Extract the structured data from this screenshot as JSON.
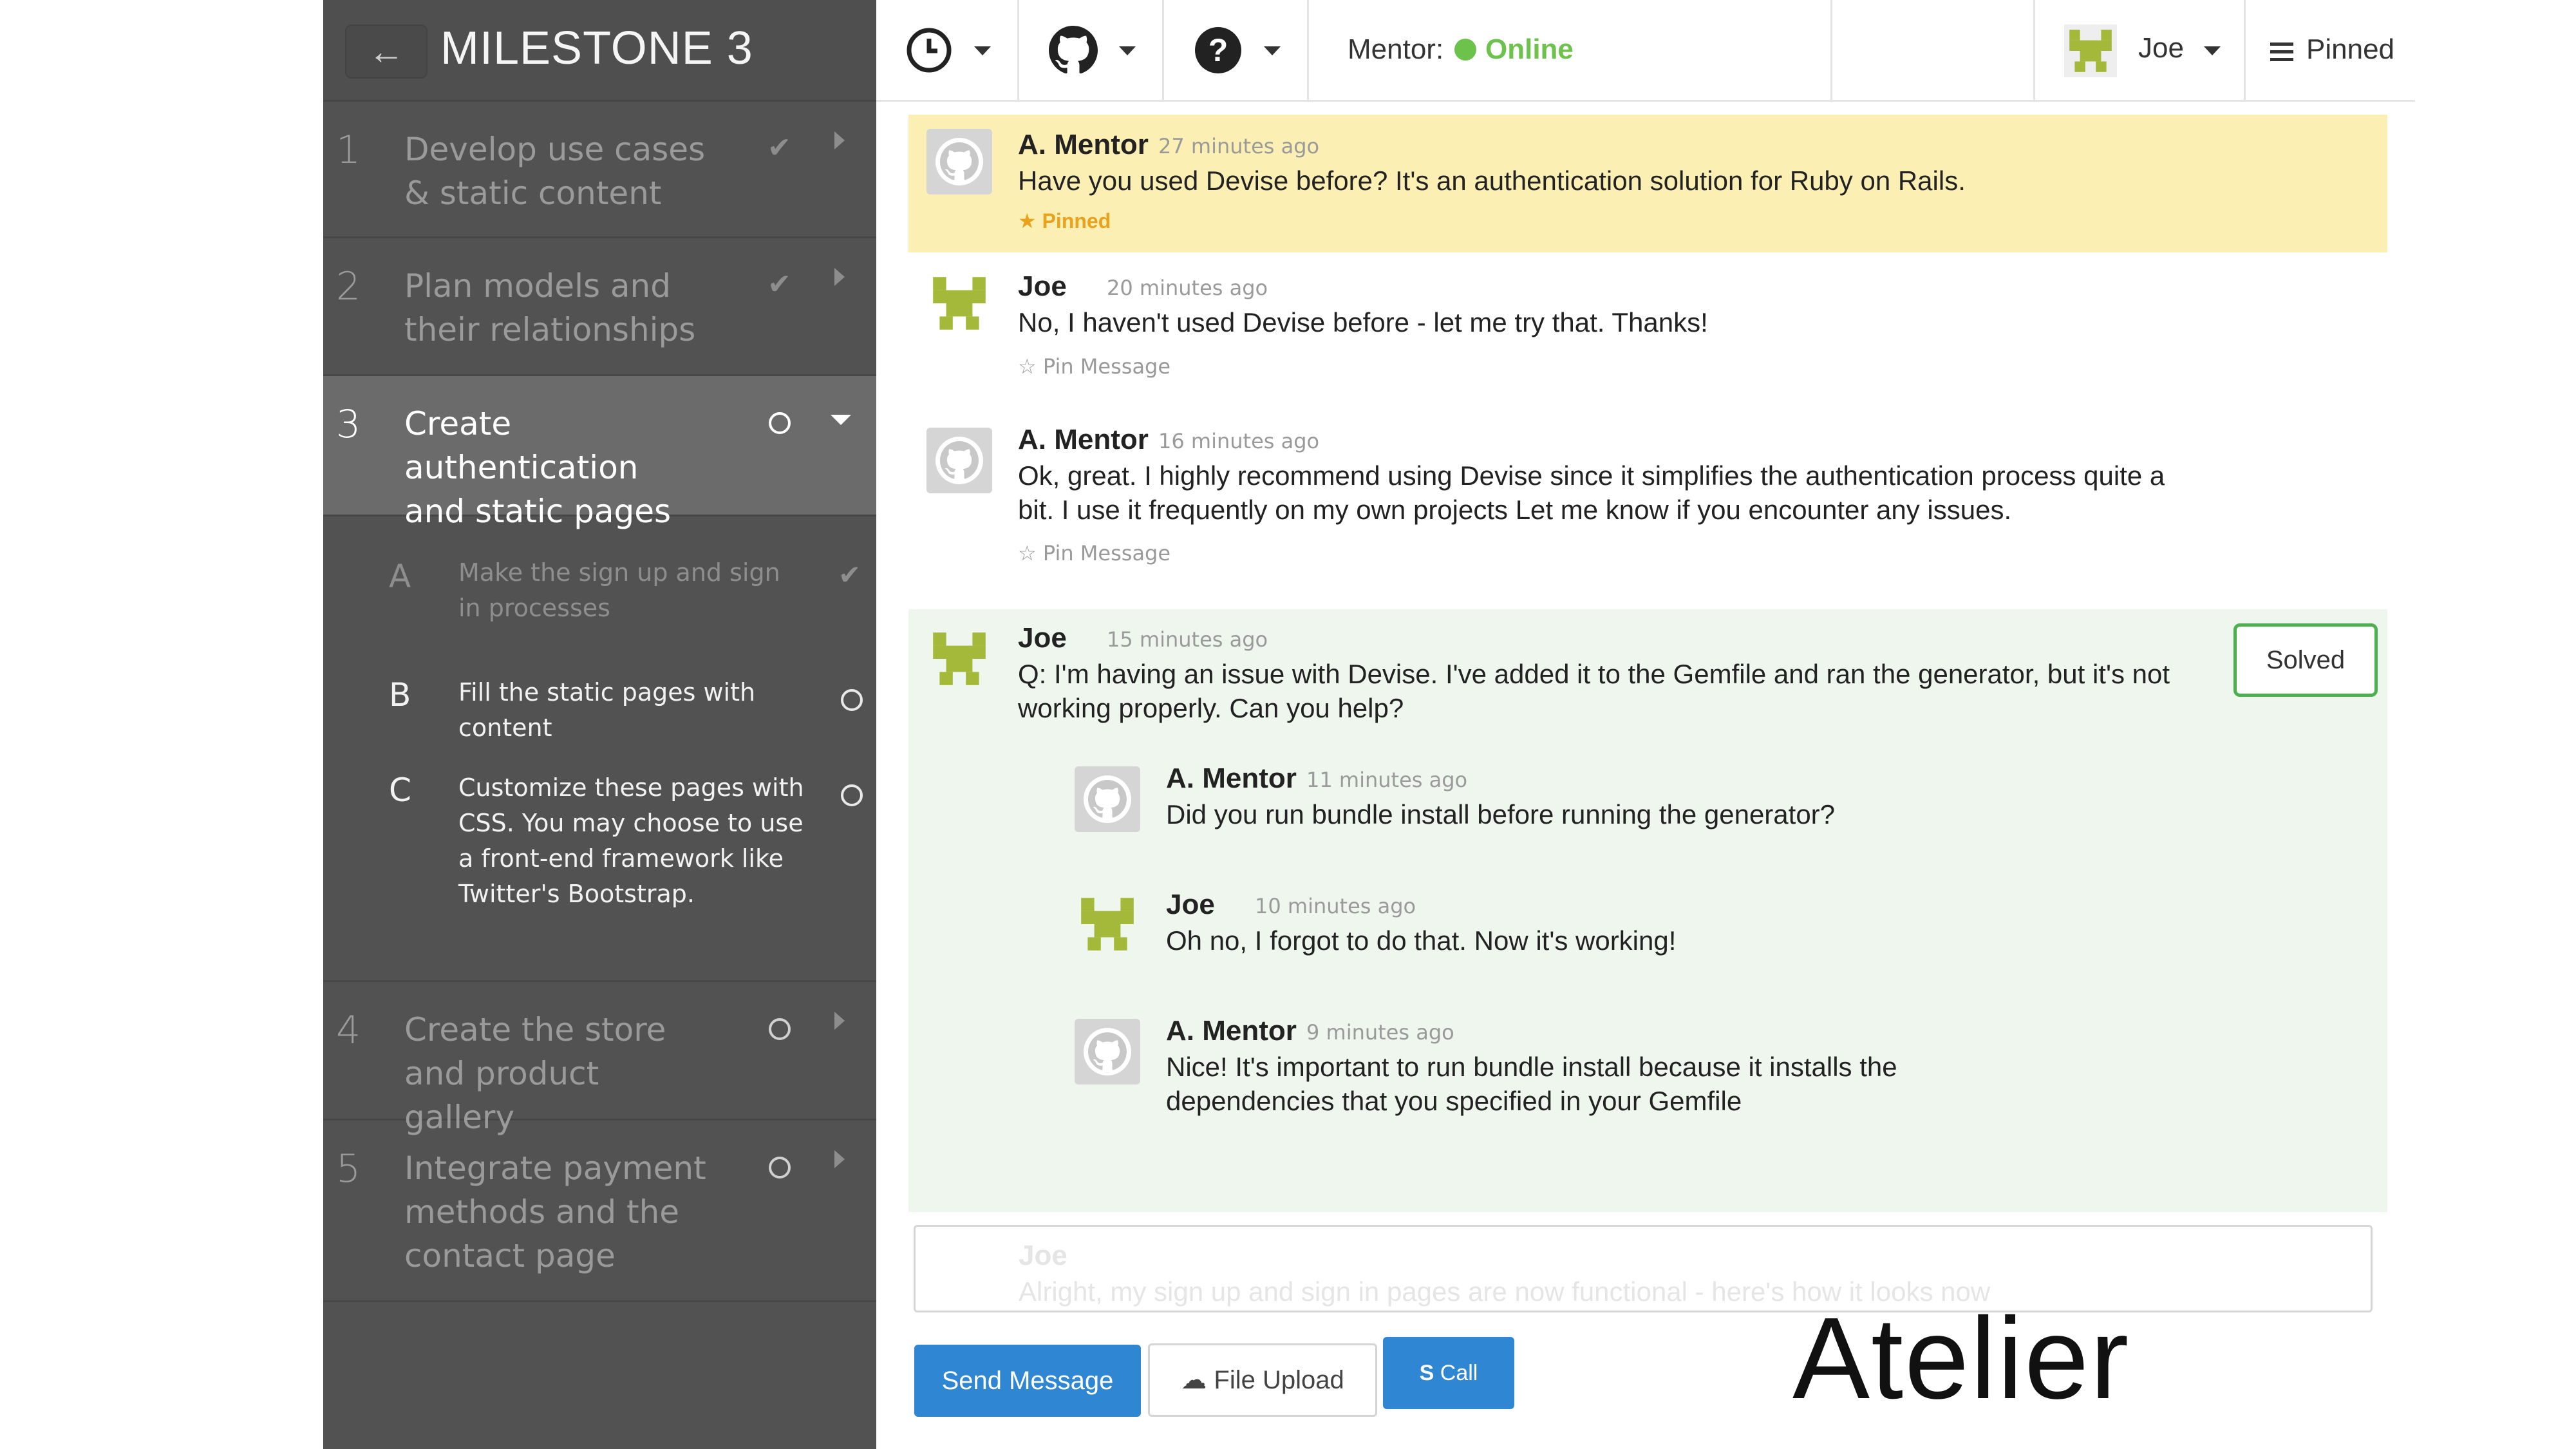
{
  "sidebar": {
    "back_icon": "back-arrow-icon",
    "back_glyph": "←",
    "milestone_title": "MILESTONE 3",
    "steps": [
      {
        "num": "1",
        "text": "Develop use cases & static content",
        "status": "done"
      },
      {
        "num": "2",
        "text": "Plan models and their relationships",
        "status": "done"
      },
      {
        "num": "3",
        "text": "Create authentication and static pages",
        "status": "active"
      },
      {
        "num": "4",
        "text": "Create the store and product gallery",
        "status": "todo"
      },
      {
        "num": "5",
        "text": "Integrate payment methods and the contact page",
        "status": "todo"
      }
    ],
    "substeps": [
      {
        "letter": "A",
        "text": "Make the sign up and sign in processes",
        "status": "done"
      },
      {
        "letter": "B",
        "text": "Fill the static pages with content",
        "status": "todo"
      },
      {
        "letter": "C",
        "text": "Customize these pages with CSS. You may choose to use a front-end framework like Twitter's Bootstrap.",
        "status": "todo"
      }
    ]
  },
  "topbar": {
    "mentor_label": "Mentor:",
    "mentor_status": "Online",
    "user_name": "Joe",
    "pinned_label": "Pinned",
    "icons": [
      "clock-icon",
      "github-icon",
      "help-icon"
    ]
  },
  "messages": [
    {
      "author": "A. Mentor",
      "time": "27 minutes ago",
      "text": "Have you used Devise before? It's an authentication solution for Ruby on Rails.",
      "pinned_label": "Pinned"
    },
    {
      "author": "Joe",
      "time": "20 minutes ago",
      "text": "No, I haven't used Devise before - let me try that. Thanks!",
      "pin_label": "Pin Message"
    },
    {
      "author": "A. Mentor",
      "time": "16 minutes ago",
      "text": "Ok, great. I highly recommend using Devise since it simplifies the authentication process quite a bit. I use it frequently on my own projects Let me know if you encounter any issues.",
      "pin_label": "Pin Message"
    },
    {
      "author": "Joe",
      "time": "15 minutes ago",
      "text": "Q: I'm having an issue with Devise. I've added it to the Gemfile and ran the generator, but it's not working properly. Can you help?",
      "solved_label": "Solved",
      "replies": [
        {
          "author": "A. Mentor",
          "time": "11 minutes ago",
          "text": "Did you run bundle install before running the generator?"
        },
        {
          "author": "Joe",
          "time": "10 minutes ago",
          "text": "Oh no, I forgot to do that. Now it's working!"
        },
        {
          "author": "A. Mentor",
          "time": "9 minutes ago",
          "text": "Nice! It's important to run bundle install because it installs the dependencies that you specified in your Gemfile"
        }
      ]
    }
  ],
  "composer": {
    "ghost_author": "Joe",
    "ghost_text": "Alright, my sign up and sign in pages are now functional - here's how it looks now"
  },
  "buttons": {
    "send": "Send Message",
    "upload": "File Upload",
    "call": "Call"
  },
  "watermark": "Atelier",
  "colors": {
    "sidebar": "#525252",
    "pinned_bg": "#fcefb4",
    "thread_bg": "#eef6ee",
    "online": "#6cc24a",
    "primary": "#2f86d2",
    "solved_border": "#4caf50",
    "joe_avatar": "#a4b83a"
  }
}
